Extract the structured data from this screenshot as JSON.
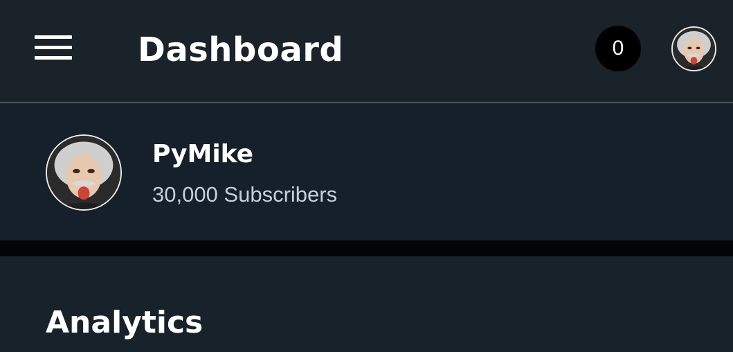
{
  "header": {
    "title": "Dashboard",
    "notification_count": "0"
  },
  "profile": {
    "name": "PyMike",
    "subscribers": "30,000 Subscribers"
  },
  "analytics": {
    "title": "Analytics"
  },
  "icons": {
    "menu": "hamburger-menu-icon",
    "avatar": "avatar-image"
  },
  "colors": {
    "background": "#18222b",
    "header_background": "#1a222a",
    "divider": "#020405",
    "badge_background": "#000000",
    "subtitle_text": "#c4d0da"
  }
}
